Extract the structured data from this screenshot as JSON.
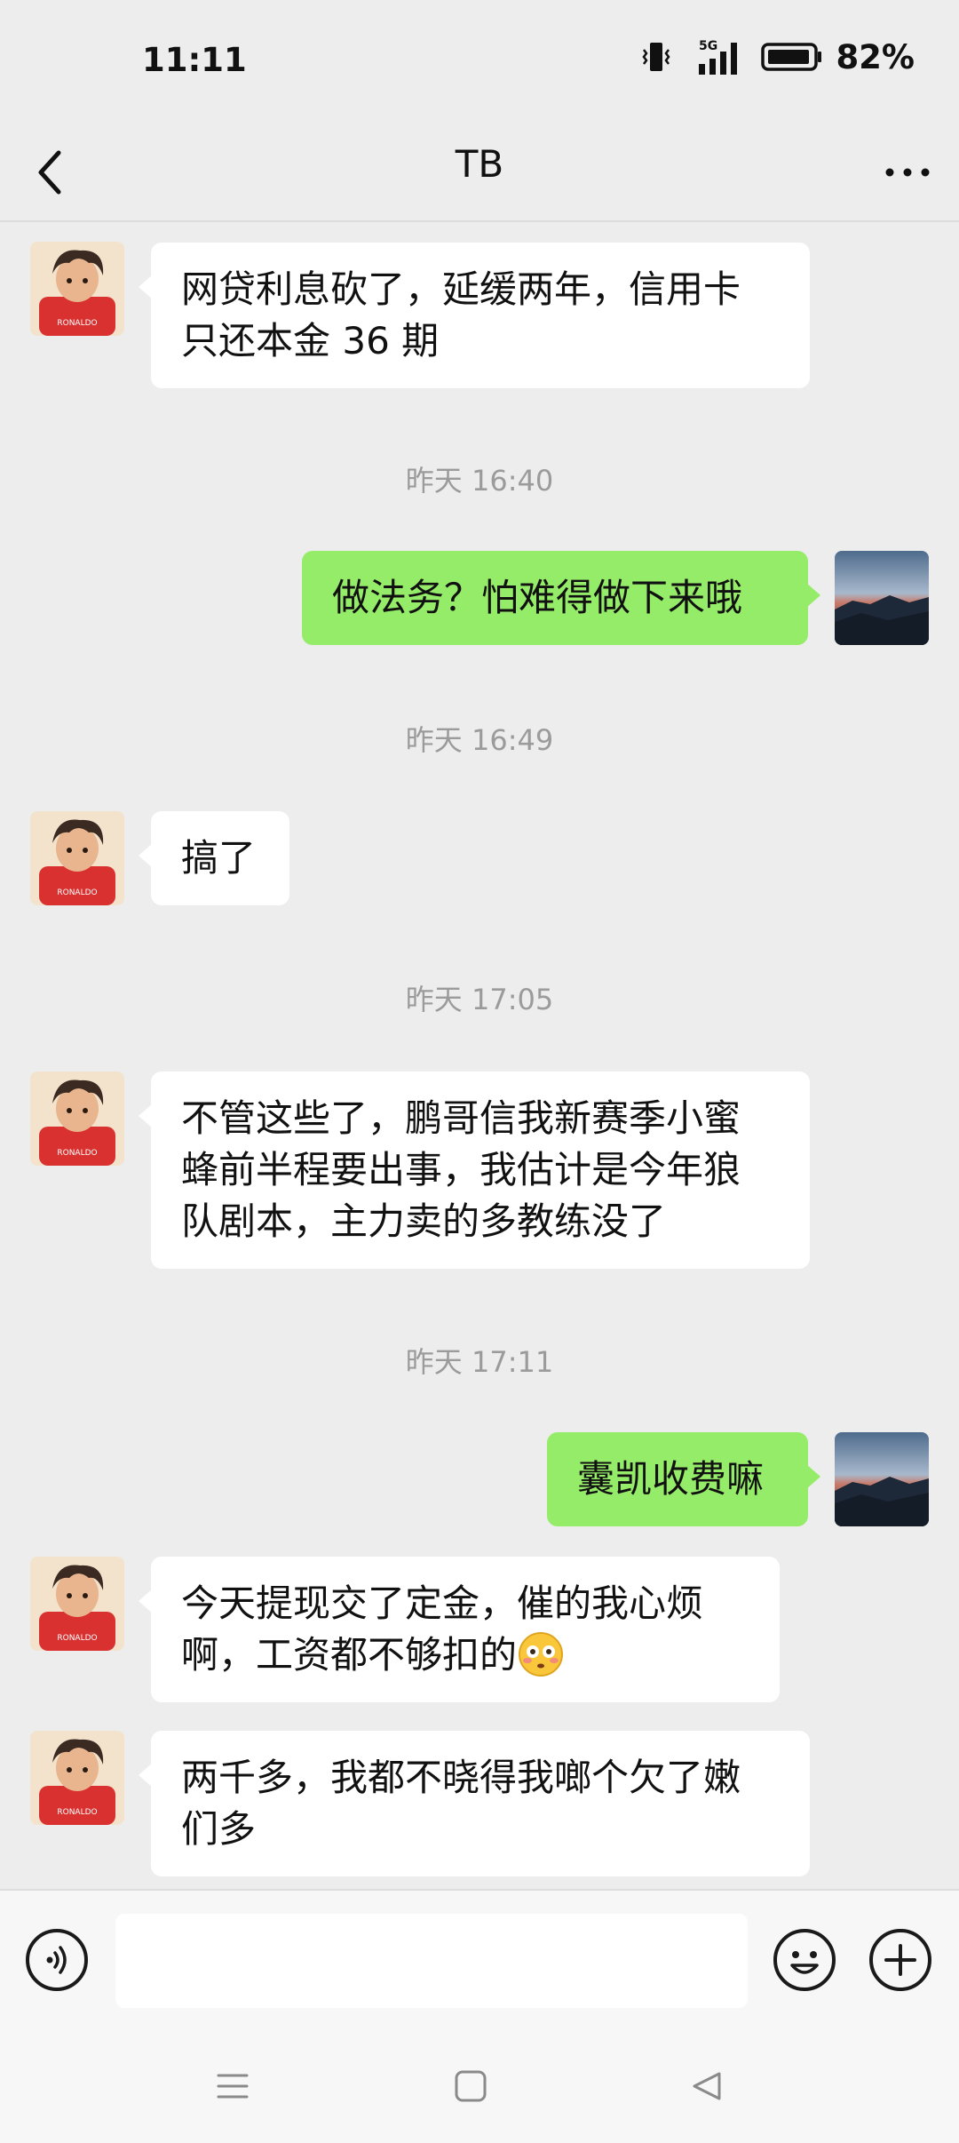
{
  "status_bar": {
    "time": "11:11",
    "network": "5G",
    "battery": "82%"
  },
  "header": {
    "title": "TB"
  },
  "timestamps": [
    "昨天 16:40",
    "昨天 16:49",
    "昨天 17:05",
    "昨天 17:11"
  ],
  "messages": [
    {
      "side": "in",
      "lines": [
        "网贷利息砍了，延缓两年，信用卡",
        "只还本金 36 期"
      ]
    },
    {
      "side": "out",
      "lines": [
        "做法务？怕难得做下来哦"
      ]
    },
    {
      "side": "in",
      "lines": [
        "搞了"
      ]
    },
    {
      "side": "in",
      "lines": [
        "不管这些了，鹏哥信我新赛季小蜜",
        "蜂前半程要出事，我估计是今年狼",
        "队剧本，主力卖的多教练没了"
      ]
    },
    {
      "side": "out",
      "lines": [
        "囊凯收费嘛"
      ]
    },
    {
      "side": "in",
      "lines": [
        "今天提现交了定金，催的我心烦",
        "啊，工资都不够扣的"
      ]
    },
    {
      "side": "in",
      "lines": [
        "两千多，我都不晓得我啷个欠了嫩",
        "们多"
      ]
    }
  ],
  "icons": {
    "back": "chevron-left-icon",
    "more": "more-dots-icon",
    "voice": "voice-icon",
    "emoji": "emoji-icon",
    "add": "plus-icon",
    "nav_menu": "menu-icon",
    "nav_home": "home-icon",
    "nav_back": "back-triangle-icon"
  },
  "colors": {
    "background": "#ededed",
    "outgoing_bubble": "#95ec69",
    "incoming_bubble": "#ffffff",
    "timestamp": "#9b9b9b"
  }
}
